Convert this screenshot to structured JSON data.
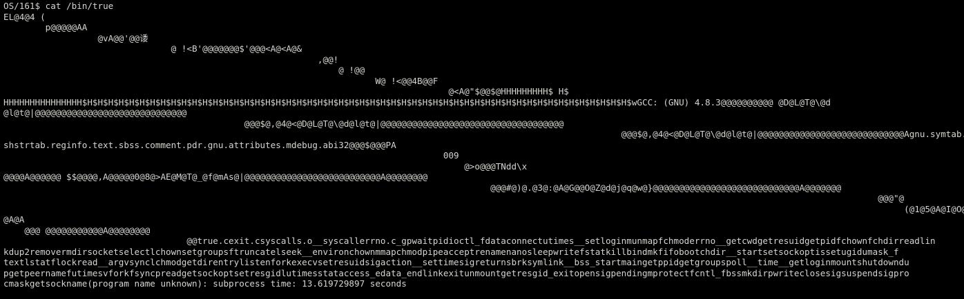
{
  "terminal": {
    "prompt": "OS/161$ ",
    "command": "cat /bin/true",
    "output_lines": [
      "EL@4@4 (",
      "        p@@@@@AA",
      "                  @vA@@'@@诿",
      "                                @ !<B'@@@@@@@$'@@@<A@<A@&",
      "                                                            ,@@!",
      "                                                                @ !@@",
      "                                                                       W@ !<@@4B@@F",
      "                                                                                     @<A@\"$@@$@HHHHHHHHH$ H$",
      "HHHHHHHHHHHHHHH$H$H$H$H$H$H$H$H$H$H$H$H$H$H$H$H$H$H$H$H$H$H$H$H$H$H$H$H$H$H$H$H$H$H$H$H$H$H$H$H$H$H$H$H$H$H$H$H$H$H$H$H$wGCC: (GNU) 4.8.3@@@@@@@@@@ @D@L@T@\\@d",
      "@l@t@|@@@@@@@@@@@@@@@@@@@@@@@@@@@@@",
      "                                              @@@$@,@4@<@D@L@T@\\@d@l@t@|@@@@@@@@@@@@@@@@@@@@@@@@@@@@@@@@@@@",
      "                                                                                                                      @@@$@,@4@<@D@L@T@\\@d@l@t@|@@@@@@@@@@@@@@@@@@@@@@@@@@@@Agnu.symtab.strtab.",
      "shstrtab.reginfo.text.sbss.comment.pdr.gnu.attributes.mdebug.abi32@@@$@@@PA",
      "                                                                                    009",
      "                                                                                        @>o@@@TNdd\\x",
      "@@@@A@@@@@@ $$@@@@,A@@@@@0@8@>AE@M@T@_@f@mAs@|@@@@@@@@@@@@@@@@@@@@@@@@@@A@@@@@@@@",
      "                                                                                             @@@#@)@.@3@:@A@G@@O@Z@d@j@q@w@}@@@@@@@@@@@@@@@@@@@@@@@@@@@@A@@@@@@@",
      "                                                                                                                                                                       @@@\"@",
      "                                                                                                                                                                            (@1@5@A@I@O@U@[@f@p@}@",
      "@A@A",
      "    @@@ @@@@@@@@@@@A@@@@@@@@",
      "                                   @@true.cexit.csyscalls.o__syscallerrno.c_gpwaitpidioctl_fdataconnectutimes__setloginmunmapfchmoderrno__getcwdgetresuidgetpidfchownfchdirreadlin",
      "kdup2removermdirsocketselectlchownsetgroupsftruncatelseek__environchownmmapchmodpipeacceptrenamenanosleepwritefstatkillbindmkfifobootchdir__startsetsockoptissetugidumask_f",
      "textlstatflockread__argvsynclchmodgetdirentrylistenforkexecvsetresuidsigaction__settimesigreturnsbrksymlink__bss_startmaingetppidgetgroupspoll__time__getloginmountshutdowndu",
      "pgetpeernamefutimesvforkfsyncpreadgetsockoptsetresgidlutimesstataccess_edata_endlinkexitunmountgetresgid_exitopensigpendingmprotectfcntl_fbssmkdirpwriteclosesigsuspendsigpro",
      "cmaskgetsockname(program name unknown): subprocess time: 13.619729897 seconds"
    ]
  }
}
